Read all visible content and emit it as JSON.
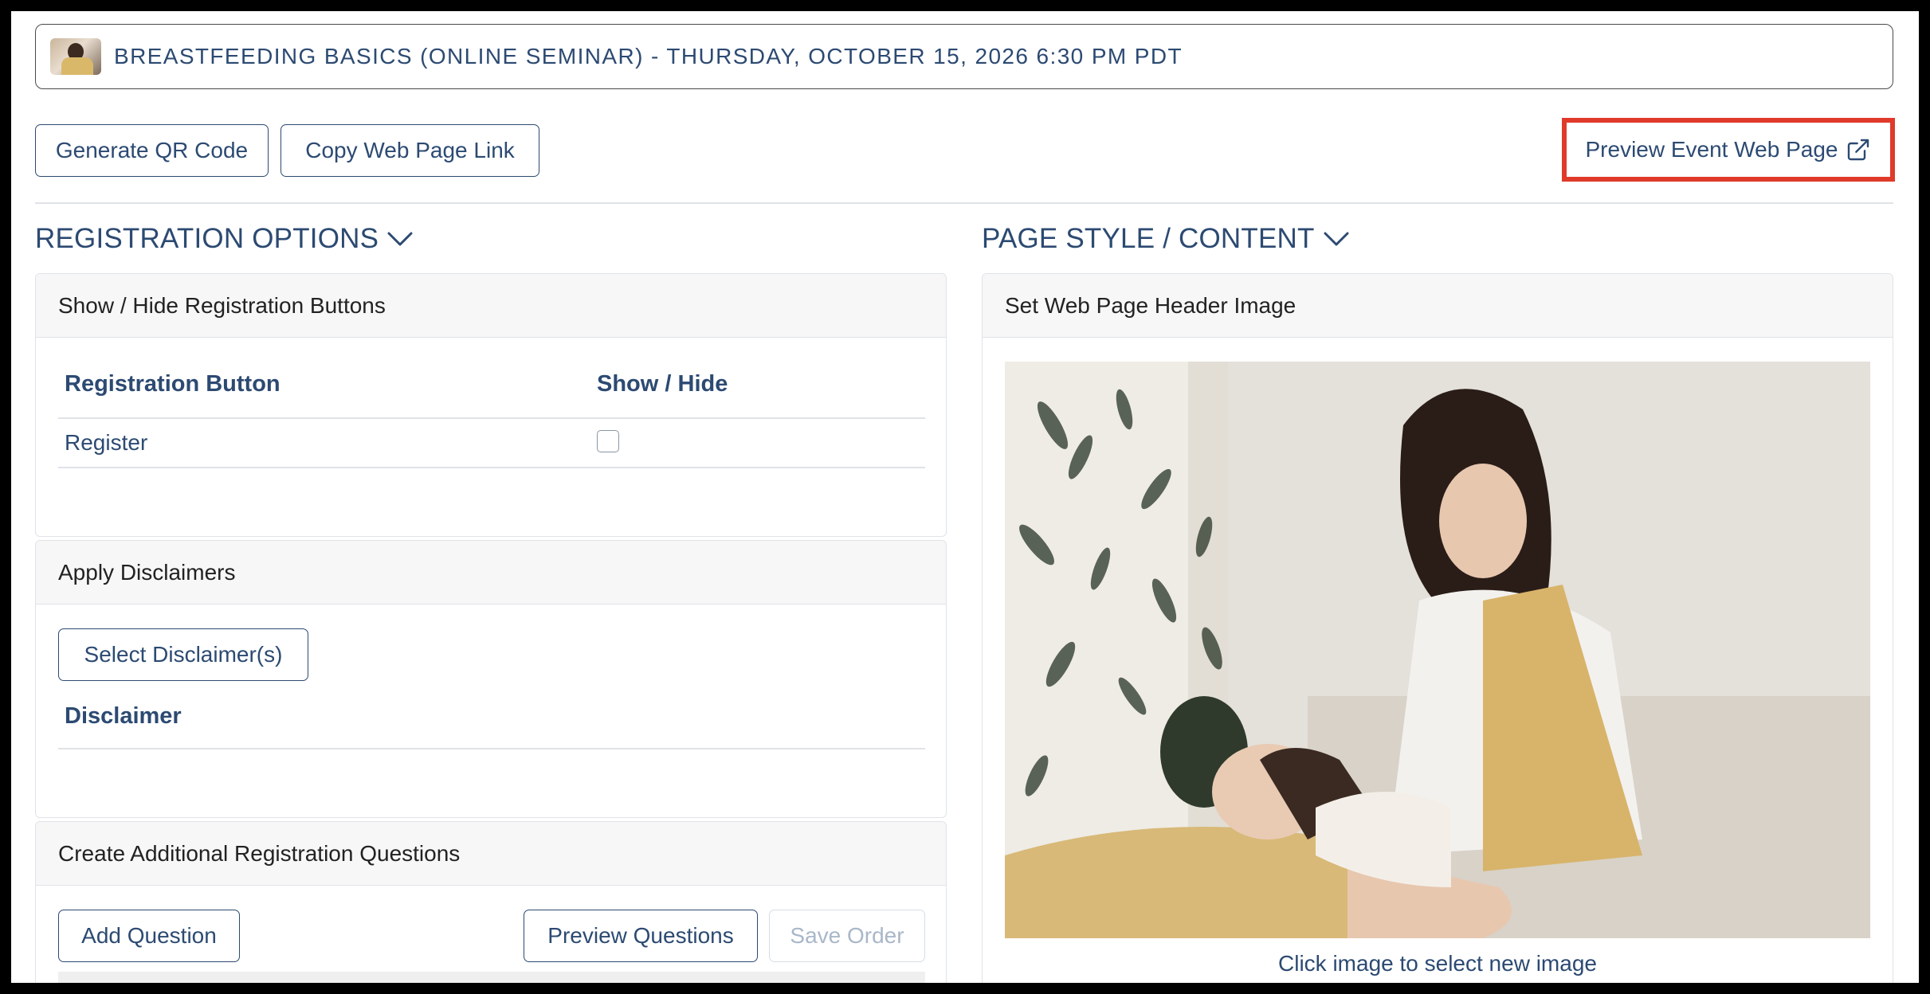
{
  "event": {
    "title": "BREASTFEEDING BASICS (ONLINE SEMINAR) - THURSDAY, OCTOBER 15, 2026 6:30 PM PDT"
  },
  "toolbar": {
    "generate_qr": "Generate QR Code",
    "copy_link": "Copy Web Page Link",
    "preview_page": "Preview Event Web Page"
  },
  "registration": {
    "heading": "REGISTRATION OPTIONS",
    "buttons_card": {
      "title": "Show / Hide Registration Buttons",
      "columns": [
        "Registration Button",
        "Show / Hide"
      ],
      "rows": [
        {
          "label": "Register",
          "shown": false
        }
      ]
    },
    "disclaimers_card": {
      "title": "Apply Disclaimers",
      "select_button": "Select Disclaimer(s)",
      "column": "Disclaimer"
    },
    "questions_card": {
      "title": "Create Additional Registration Questions",
      "add_button": "Add Question",
      "preview_button": "Preview Questions",
      "save_button": "Save Order"
    }
  },
  "page_style": {
    "heading": "PAGE STYLE / CONTENT",
    "header_image_card": {
      "title": "Set Web Page Header Image",
      "caption": "Click image to select new image"
    }
  },
  "colors": {
    "primary": "#2c4a72",
    "highlight": "#e03a2a",
    "border": "#dfe3e8"
  }
}
